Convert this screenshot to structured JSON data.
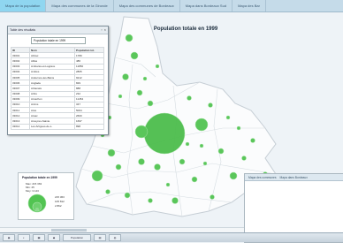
{
  "topbar": {
    "tabs": [
      "Mapa de la population",
      "Mapa des communes de la Gironde",
      "Mapa des communes de Bordeaux",
      "Mapa dans Bordeaux Sud",
      "Mapa des Bar"
    ]
  },
  "map": {
    "title": "Population totale en 1999",
    "accent": "#3bbf3b"
  },
  "table_window": {
    "title": "Table des résultats",
    "select_value": "Population totale en 1999",
    "columns": [
      "ID",
      "Nom",
      "Population tot."
    ],
    "rows": [
      [
        "33001",
        "Abzac",
        "1780"
      ],
      [
        "33002",
        "Aillas",
        "486"
      ],
      [
        "33003",
        "Ambarès-et-Lagrave",
        "11850"
      ],
      [
        "33004",
        "Ambès",
        "2805"
      ],
      [
        "33005",
        "Andernos-les-Bains",
        "9212"
      ],
      [
        "33006",
        "Anglade",
        "829"
      ],
      [
        "33007",
        "Arbanats",
        "888"
      ],
      [
        "33008",
        "Arbis",
        "232"
      ],
      [
        "33009",
        "Arcachon",
        "11454"
      ],
      [
        "33010",
        "Arcins",
        "347"
      ],
      [
        "33011",
        "Arès",
        "5064"
      ],
      [
        "33012",
        "Arsac",
        "2600"
      ],
      [
        "33013",
        "Arveyres-Sainte",
        "1697"
      ],
      [
        "33014",
        "Les Artigues-de-L.",
        "898"
      ]
    ]
  },
  "legend": {
    "title": "Population totale en 1999",
    "stats": [
      "Max: 215 363",
      "Min: 25",
      "Moy: 3 143"
    ],
    "labels": [
      "215 363",
      "105 812",
      "2 862"
    ]
  },
  "second_window": {
    "tabs": [
      "Mapa des communes",
      "Mapa dans Bordeaux"
    ]
  },
  "taskbar": {
    "active_label": "Population"
  }
}
